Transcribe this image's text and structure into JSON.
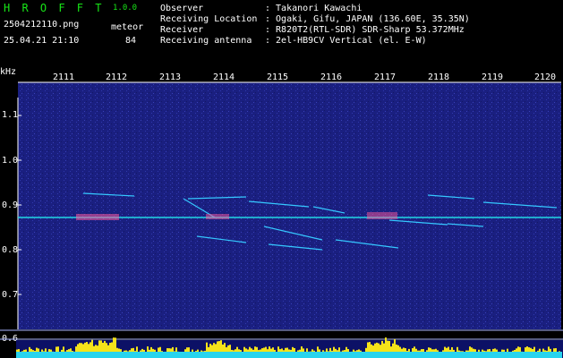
{
  "header": {
    "app_name": "H R O F F T",
    "version": "1.0.0",
    "filename": "2504212110.png",
    "datetime": "25.04.21 21:10",
    "meteor_label": "meteor",
    "meteor_count": "84",
    "info": [
      {
        "label": "Observer",
        "value": ": Takanori Kawachi"
      },
      {
        "label": "Receiving Location",
        "value": ": Ogaki, Gifu, JAPAN (136.60E, 35.35N)"
      },
      {
        "label": "Receiver",
        "value": ": R820T2(RTL-SDR) SDR-Sharp 53.372MHz"
      },
      {
        "label": "Receiving antenna",
        "value": ": 2el-HB9CV Vertical (el. E-W)"
      }
    ]
  },
  "axis": {
    "y_unit": "kHz",
    "y_ticks": [
      "1.1",
      "1.0",
      "0.9",
      "0.8",
      "0.7",
      "0.6"
    ],
    "x_ticks": [
      "2111",
      "2112",
      "2113",
      "2114",
      "2115",
      "2116",
      "2117",
      "2118",
      "2119",
      "2120"
    ]
  },
  "colors": {
    "background": "#000000",
    "waterfall": "#1a1f80",
    "carrier": "#22d8e6",
    "meteor": "#35c8ff",
    "level_yellow": "#f5e31a",
    "level_cyan": "#28d4ee",
    "title_green": "#17e617"
  }
}
